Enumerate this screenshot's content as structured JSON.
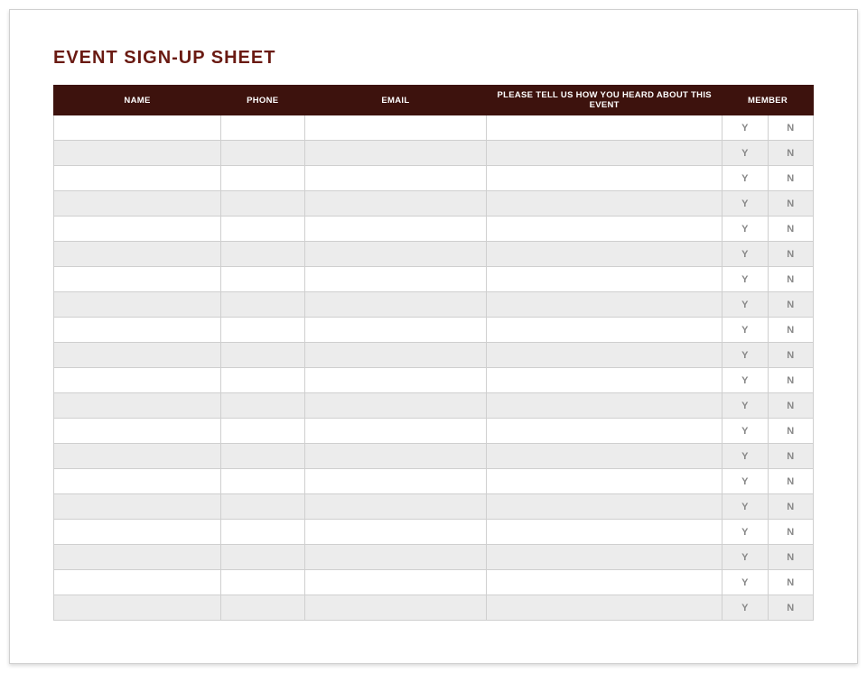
{
  "title": "EVENT SIGN-UP SHEET",
  "columns": {
    "name": "NAME",
    "phone": "PHONE",
    "email": "EMAIL",
    "heard": "PLEASE TELL US HOW YOU HEARD ABOUT THIS EVENT",
    "member": "MEMBER"
  },
  "member_options": {
    "yes": "Y",
    "no": "N"
  },
  "row_count": 20,
  "rows": [
    {
      "name": "",
      "phone": "",
      "email": "",
      "heard": ""
    },
    {
      "name": "",
      "phone": "",
      "email": "",
      "heard": ""
    },
    {
      "name": "",
      "phone": "",
      "email": "",
      "heard": ""
    },
    {
      "name": "",
      "phone": "",
      "email": "",
      "heard": ""
    },
    {
      "name": "",
      "phone": "",
      "email": "",
      "heard": ""
    },
    {
      "name": "",
      "phone": "",
      "email": "",
      "heard": ""
    },
    {
      "name": "",
      "phone": "",
      "email": "",
      "heard": ""
    },
    {
      "name": "",
      "phone": "",
      "email": "",
      "heard": ""
    },
    {
      "name": "",
      "phone": "",
      "email": "",
      "heard": ""
    },
    {
      "name": "",
      "phone": "",
      "email": "",
      "heard": ""
    },
    {
      "name": "",
      "phone": "",
      "email": "",
      "heard": ""
    },
    {
      "name": "",
      "phone": "",
      "email": "",
      "heard": ""
    },
    {
      "name": "",
      "phone": "",
      "email": "",
      "heard": ""
    },
    {
      "name": "",
      "phone": "",
      "email": "",
      "heard": ""
    },
    {
      "name": "",
      "phone": "",
      "email": "",
      "heard": ""
    },
    {
      "name": "",
      "phone": "",
      "email": "",
      "heard": ""
    },
    {
      "name": "",
      "phone": "",
      "email": "",
      "heard": ""
    },
    {
      "name": "",
      "phone": "",
      "email": "",
      "heard": ""
    },
    {
      "name": "",
      "phone": "",
      "email": "",
      "heard": ""
    },
    {
      "name": "",
      "phone": "",
      "email": "",
      "heard": ""
    }
  ]
}
